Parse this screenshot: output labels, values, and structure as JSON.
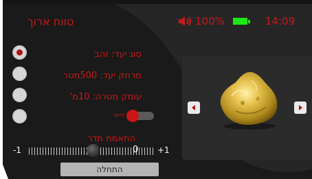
{
  "screen": {
    "title": "טווח ארוך"
  },
  "status": {
    "volume": "100%",
    "battery": "full",
    "time": "14:09"
  },
  "settings": {
    "target_type": "סוג יעד: זהב",
    "target_distance": "מרחק יעד: 500מטר",
    "target_depth": "עומק מטרה: 10מ'",
    "laser_label": "לייזר",
    "laser_enabled": true
  },
  "frequency": {
    "title": "התאמת תדר",
    "min": "-1",
    "max": "+1",
    "value": "0",
    "level": 0.5
  },
  "actions": {
    "start_label": "התחלה"
  },
  "gallery": {
    "item": "gold-nugget"
  },
  "icons": [
    "speaker-icon",
    "battery-icon",
    "left-arrow-icon",
    "right-arrow-icon"
  ],
  "colors": {
    "accent": "#c81818",
    "battery": "#1ee814",
    "background": "#1c1c1c",
    "card": "#2b2b2b"
  }
}
